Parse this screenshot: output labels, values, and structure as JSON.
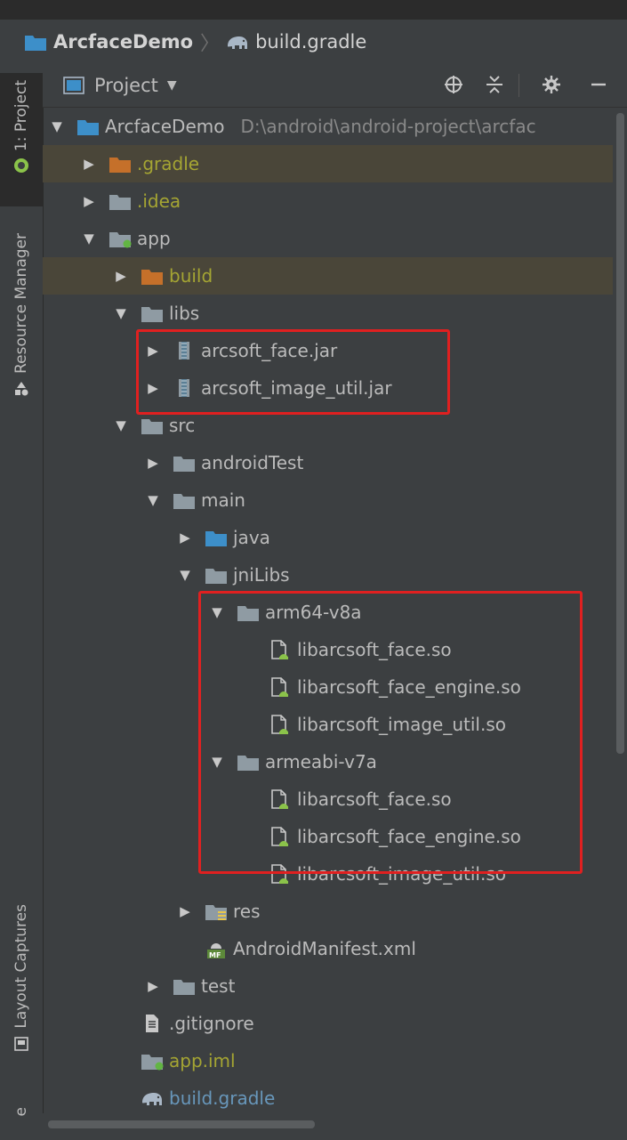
{
  "breadcrumb": {
    "project": "ArcfaceDemo",
    "file": "build.gradle"
  },
  "sidebar": {
    "tabs": [
      {
        "label": "1: Project",
        "active": true
      },
      {
        "label": "Resource Manager",
        "active": false
      },
      {
        "label": "Layout Captures",
        "active": false
      }
    ],
    "bottom_letter": "e"
  },
  "toolbar": {
    "view_label": "Project"
  },
  "root": {
    "name": "ArcfaceDemo",
    "path": "D:\\android\\android-project\\arcfac"
  },
  "tree": {
    "gradle": ".gradle",
    "idea": ".idea",
    "app": "app",
    "build": "build",
    "libs": "libs",
    "jar_face": "arcsoft_face.jar",
    "jar_image": "arcsoft_image_util.jar",
    "src": "src",
    "androidTest": "androidTest",
    "main": "main",
    "java": "java",
    "jniLibs": "jniLibs",
    "arm64": "arm64-v8a",
    "arm64_face": "libarcsoft_face.so",
    "arm64_engine": "libarcsoft_face_engine.so",
    "arm64_image": "libarcsoft_image_util.so",
    "armeabi": "armeabi-v7a",
    "armeabi_face": "libarcsoft_face.so",
    "armeabi_engine": "libarcsoft_face_engine.so",
    "armeabi_image": "libarcsoft_image_util.so",
    "res": "res",
    "manifest": "AndroidManifest.xml",
    "test": "test",
    "gitignore": ".gitignore",
    "app_iml": "app.iml",
    "build_gradle": "build.gradle"
  },
  "colors": {
    "background": "#3c3f41",
    "highlight_row": "#4a4639",
    "excluded_text": "#a5a533",
    "annotation_box": "#e02020",
    "folder": "#8f9ba3",
    "excluded_folder": "#c5702a",
    "source_folder": "#3d8fc9",
    "android_green": "#8bc34a"
  },
  "icons": [
    "module-icon",
    "gradle-elephant-icon",
    "project-view-icon",
    "dropdown-arrow-icon",
    "locate-icon",
    "collapse-all-icon",
    "gear-icon",
    "minimize-icon",
    "folder-icon",
    "jar-icon",
    "so-file-icon",
    "manifest-icon",
    "text-file-icon",
    "android-icon",
    "resource-manager-icon",
    "layout-captures-icon"
  ]
}
